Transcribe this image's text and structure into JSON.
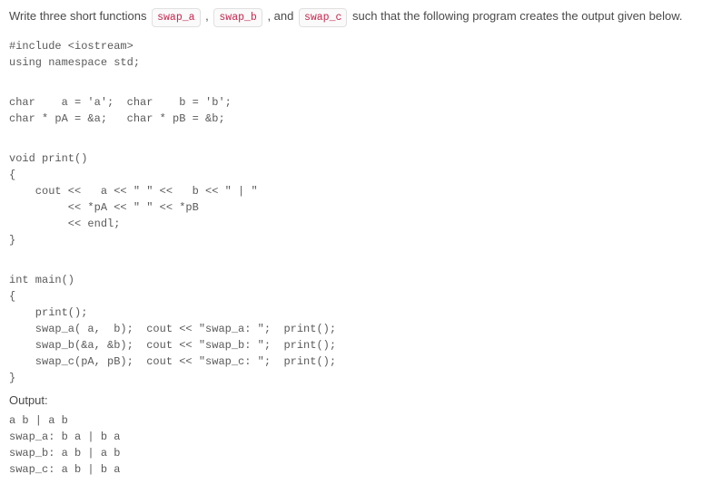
{
  "intro": {
    "prefix": "Write three short functions ",
    "badge1": "swap_a",
    "sep1": ", ",
    "badge2": "swap_b",
    "sep2": ", and ",
    "badge3": "swap_c",
    "suffix": " such that the following program creates the output given below."
  },
  "code": {
    "includes": "#include <iostream>\nusing namespace std;",
    "decls": "char    a = 'a';  char    b = 'b';\nchar * pA = &a;   char * pB = &b;",
    "printfn": "void print()\n{\n    cout <<   a << \" \" <<   b << \" | \"\n         << *pA << \" \" << *pB\n         << endl;\n}",
    "mainfn": "int main()\n{\n    print();\n    swap_a( a,  b);  cout << \"swap_a: \";  print();\n    swap_b(&a, &b);  cout << \"swap_b: \";  print();\n    swap_c(pA, pB);  cout << \"swap_c: \";  print();\n}"
  },
  "output_label": "Output:",
  "output": "a b | a b\nswap_a: b a | b a\nswap_b: a b | a b\nswap_c: a b | b a"
}
